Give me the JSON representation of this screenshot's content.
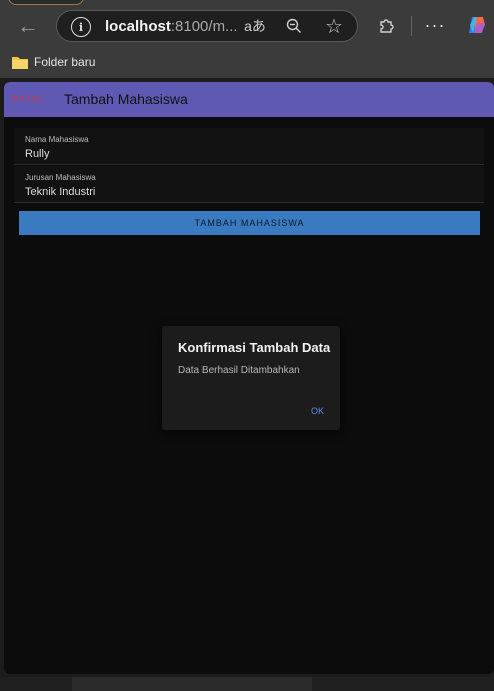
{
  "browser": {
    "url_host": "localhost",
    "url_rest": ":8100/m...",
    "read_aloud_glyph": "aあ",
    "bookmark_folder": "Folder baru",
    "icons": [
      "back-icon",
      "info-icon",
      "read-aloud-icon",
      "zoom-out-icon",
      "favorite-star-icon",
      "extensions-icon",
      "more-icon",
      "copilot-icon",
      "folder-icon"
    ]
  },
  "app": {
    "toolbar": {
      "cancel_label": "BATAL",
      "title": "Tambah Mahasiswa",
      "color": "#5f59b3"
    },
    "form": {
      "name_label": "Nama Mahasiswa",
      "name_value": "Rully",
      "major_label": "Jurusan Mahasiswa",
      "major_value": "Teknik Industri"
    },
    "submit_label": "TAMBAH MAHASISWA"
  },
  "dialog": {
    "title": "Konfirmasi Tambah Data",
    "message": "Data Berhasil Ditambahkan",
    "ok_label": "OK"
  }
}
